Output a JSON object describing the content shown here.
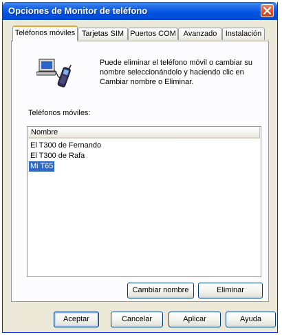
{
  "window": {
    "title": "Opciones de Monitor de teléfono"
  },
  "tabs": [
    {
      "label": "Teléfonos móviles"
    },
    {
      "label": "Tarjetas SIM"
    },
    {
      "label": "Puertos COM"
    },
    {
      "label": "Avanzado"
    },
    {
      "label": "Instalación"
    }
  ],
  "panel": {
    "info_text": "Puede eliminar el teléfono móvil o cambiar su nombre seleccionándolo y haciendo clic en Cambiar nombre o Eliminar.",
    "list_label": "Teléfonos móviles:",
    "column_header": "Nombre",
    "phones": [
      {
        "name": "El T300 de Fernando"
      },
      {
        "name": "El T300 de Rafa"
      },
      {
        "name": "Mi T65"
      }
    ],
    "selected_index": 2,
    "rename_label": "Cambiar nombre",
    "delete_label": "Eliminar"
  },
  "footer": {
    "ok_label": "Aceptar",
    "cancel_label": "Cancelar",
    "apply_label": "Aplicar",
    "help_label": "Ayuda"
  },
  "colors": {
    "title_bar": "#0053e1",
    "selection": "#316ac5",
    "active_tab_accent": "#f1a52e"
  },
  "icons": {
    "phone": "mobile-phone-computer-icon",
    "close": "close-icon"
  }
}
